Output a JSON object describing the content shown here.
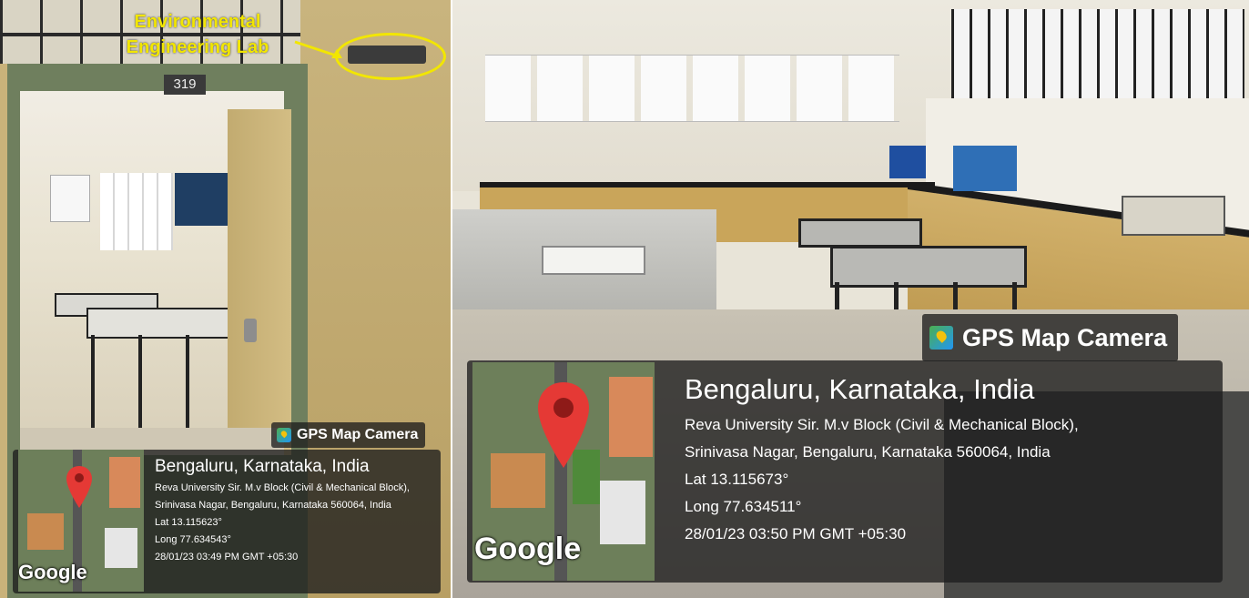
{
  "left_photo": {
    "lab_sign": "Environmental\nEngineering Lab",
    "room_number": "319",
    "badge_label": "GPS Map Camera",
    "map_brand": "Google",
    "location_title": "Bengaluru, Karnataka, India",
    "address": "Reva University Sir. M.v Block (Civil & Mechanical Block), Srinivasa Nagar, Bengaluru, Karnataka 560064, India",
    "lat": "Lat 13.115623°",
    "long": "Long 77.634543°",
    "timestamp": "28/01/23 03:49 PM GMT +05:30"
  },
  "right_photo": {
    "badge_label": "GPS Map Camera",
    "map_brand": "Google",
    "location_title": "Bengaluru, Karnataka, India",
    "address_line1": "Reva University Sir. M.v Block (Civil & Mechanical Block),",
    "address_line2": "Srinivasa Nagar, Bengaluru, Karnataka 560064, India",
    "lat": "Lat 13.115673°",
    "long": "Long 77.634511°",
    "timestamp": "28/01/23 03:50 PM GMT +05:30"
  },
  "colors": {
    "sign_text": "#f2e600",
    "pin": "#e53935",
    "overlay": "#1e1e1e"
  }
}
